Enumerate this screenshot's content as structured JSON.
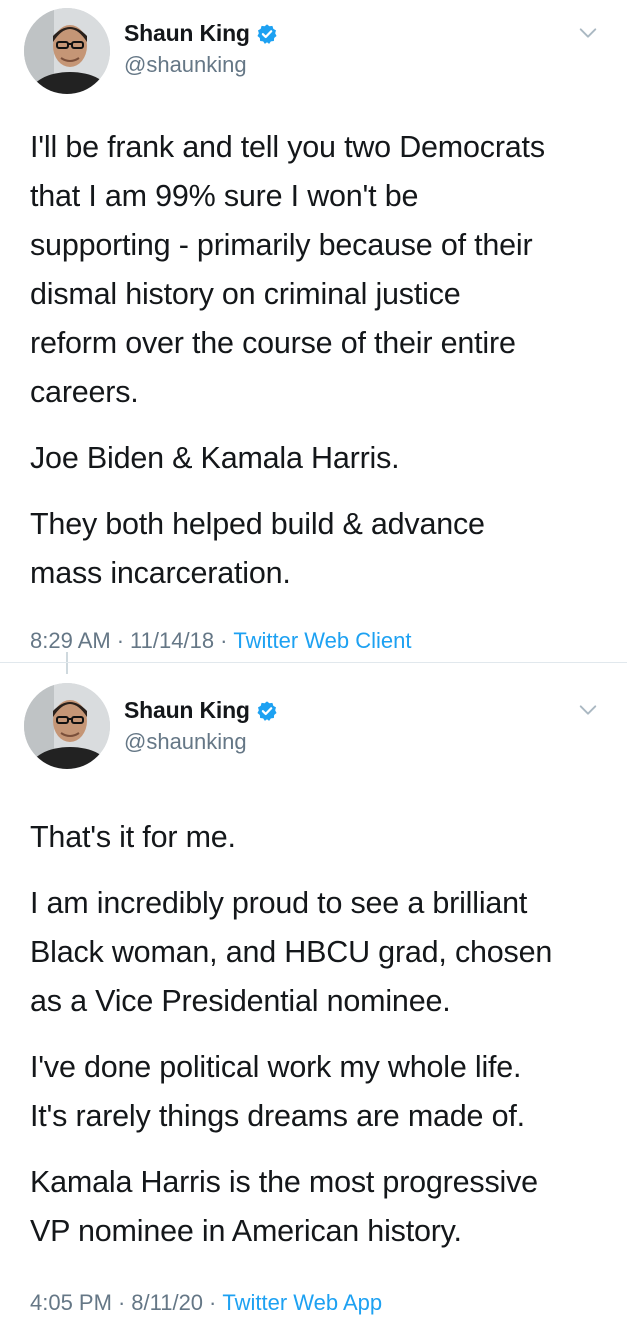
{
  "tweets": [
    {
      "author": {
        "name": "Shaun King",
        "handle": "@shaunking",
        "verified": true
      },
      "paragraphs": [
        "I'll be frank and tell you two Democrats\nthat I am 99% sure I won't be\nsupporting - primarily because of their\ndismal history on criminal justice\nreform over the course of their entire\ncareers.",
        "Joe Biden & Kamala Harris.",
        "They both helped build & advance\nmass incarceration."
      ],
      "time": "8:29 AM",
      "date": "11/14/18",
      "source": "Twitter Web Client",
      "separator": "·"
    },
    {
      "author": {
        "name": "Shaun King",
        "handle": "@shaunking",
        "verified": true
      },
      "paragraphs": [
        "That's it for me.",
        "I am incredibly proud to see a brilliant\nBlack woman, and HBCU grad, chosen\nas a Vice Presidential nominee.",
        "I've done political work my whole life.\nIt's rarely things dreams are made of.",
        "Kamala Harris is the most progressive\nVP nominee in American history."
      ],
      "time": "4:05 PM",
      "date": "8/11/20",
      "source": "Twitter Web App",
      "separator": "·"
    }
  ],
  "icons": {
    "verified": "verified-badge-icon",
    "menu": "chevron-down-icon"
  },
  "colors": {
    "text": "#14171a",
    "secondary": "#657786",
    "link": "#1da1f2",
    "divider": "#e1e8ed"
  }
}
